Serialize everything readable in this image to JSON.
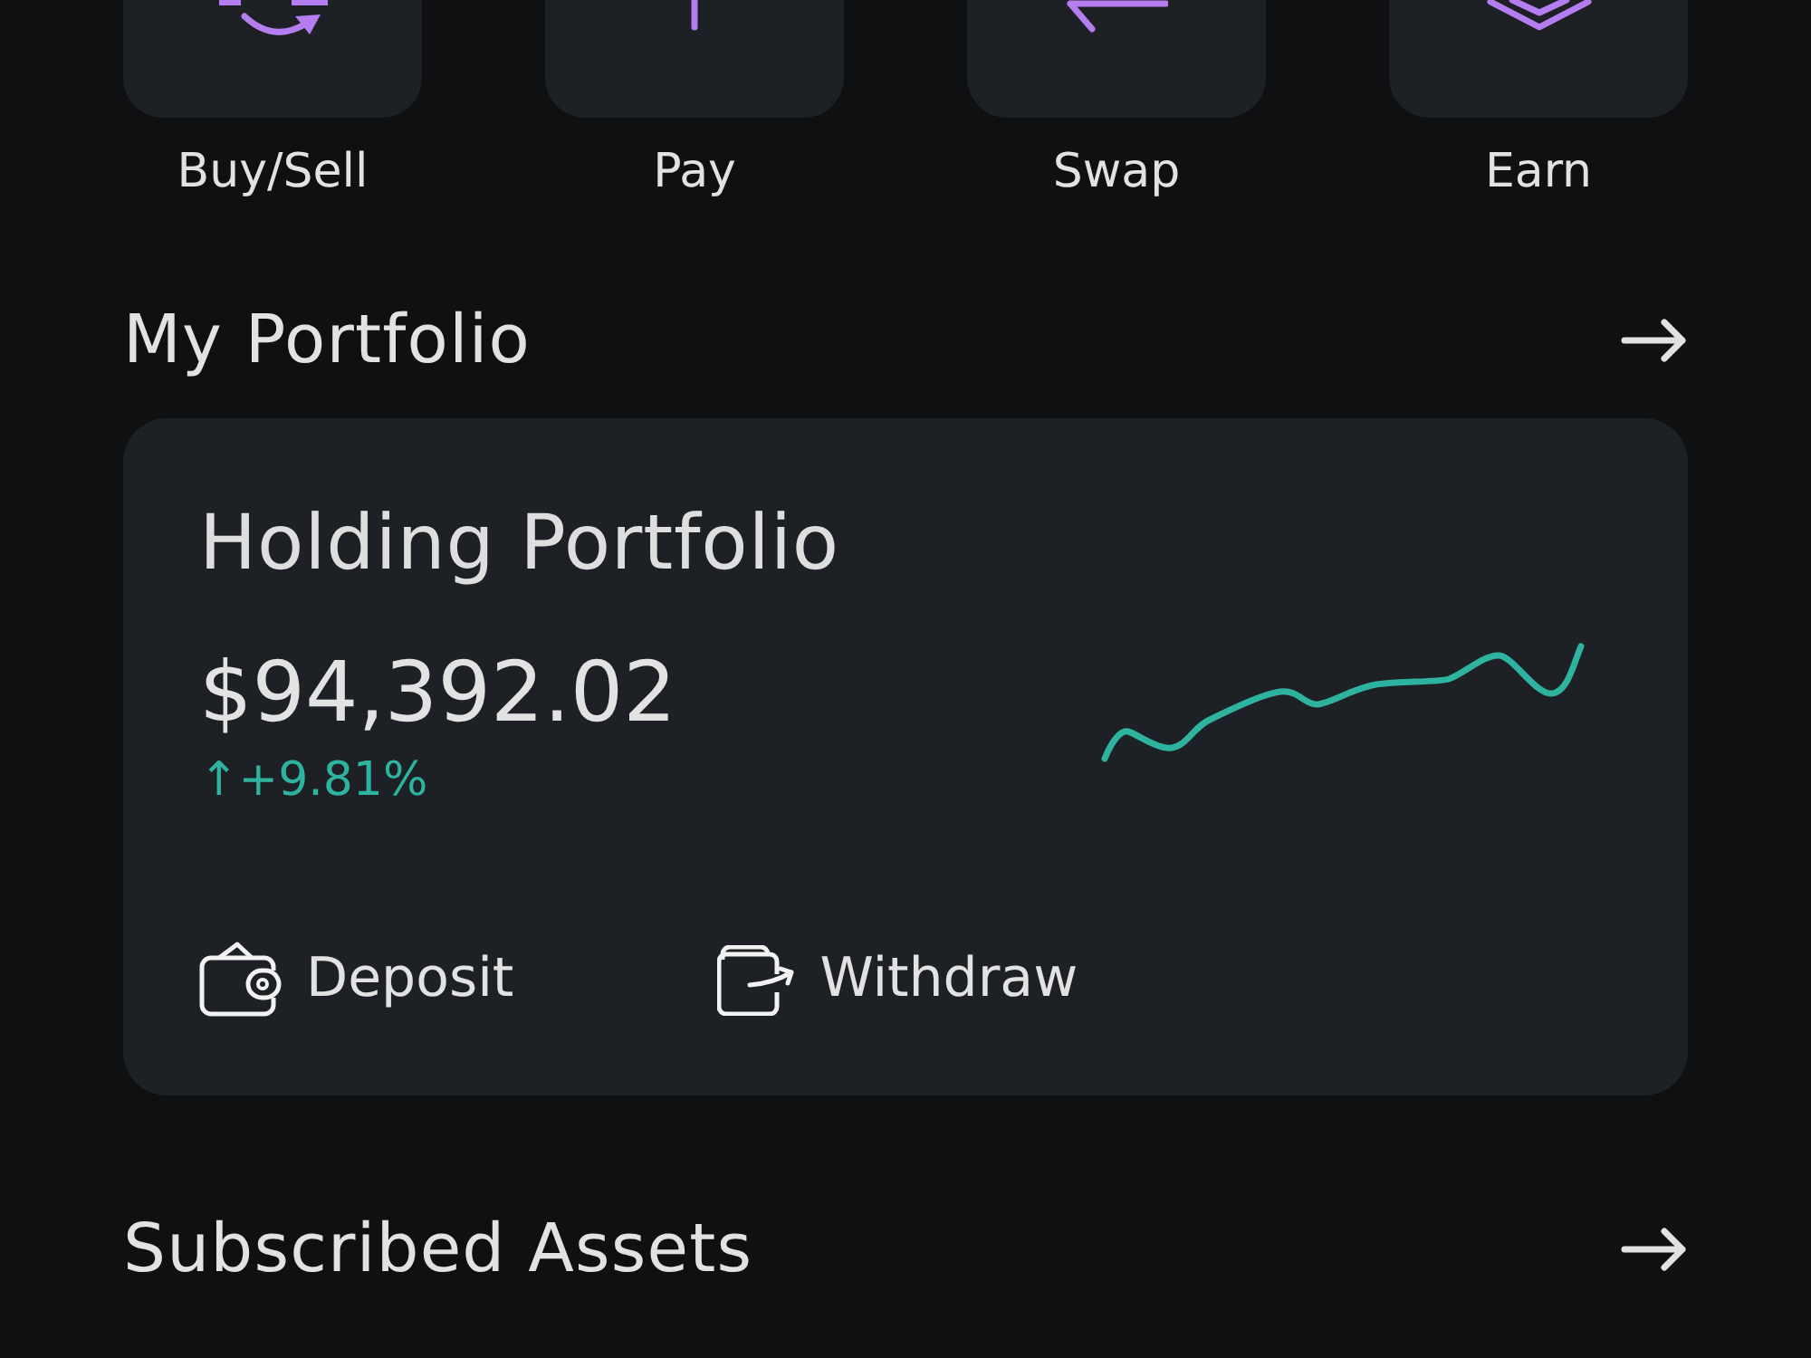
{
  "quick_actions": [
    {
      "label": "Buy/Sell",
      "kind": "buy_sell"
    },
    {
      "label": "Pay",
      "kind": "pay"
    },
    {
      "label": "Swap",
      "kind": "swap"
    },
    {
      "label": "Earn",
      "kind": "earn"
    }
  ],
  "portfolio_section": {
    "title": "My Portfolio"
  },
  "portfolio_card": {
    "title": "Holding Portfolio",
    "balance": "$94,392.02",
    "change": "↑+9.81%",
    "rising": true,
    "actions": [
      {
        "label": "Deposit",
        "kind": "deposit"
      },
      {
        "label": "Withdraw",
        "kind": "withdraw"
      }
    ]
  },
  "subscribed_section": {
    "title": "Subscribed Assets"
  }
}
